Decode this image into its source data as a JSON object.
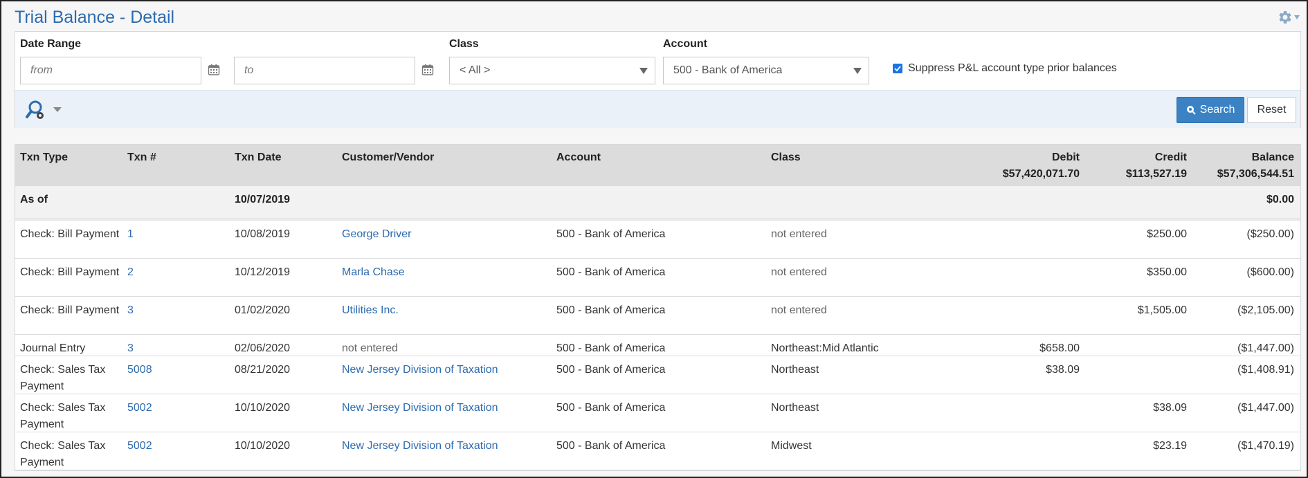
{
  "page": {
    "title": "Trial Balance - Detail"
  },
  "icons": {
    "settings": "gear-icon",
    "calendar": "calendar-icon",
    "advanced_search": "magnifier-gear-icon",
    "search": "search-icon"
  },
  "filters": {
    "date_range": {
      "label": "Date Range",
      "from_placeholder": "from",
      "to_placeholder": "to"
    },
    "class": {
      "label": "Class",
      "value": "< All >"
    },
    "account": {
      "label": "Account",
      "value": "500 - Bank of America"
    },
    "suppress": {
      "label": "Suppress P&L account type prior balances",
      "checked": true
    }
  },
  "toolbar": {
    "search_label": "Search",
    "reset_label": "Reset"
  },
  "table": {
    "headers": {
      "txn_type": "Txn Type",
      "txn_num": "Txn #",
      "txn_date": "Txn Date",
      "customer_vendor": "Customer/Vendor",
      "account": "Account",
      "class": "Class",
      "debit": "Debit",
      "credit": "Credit",
      "balance": "Balance"
    },
    "totals": {
      "debit": "$57,420,071.70",
      "credit": "$113,527.19",
      "balance": "$57,306,544.51"
    },
    "as_of": {
      "label": "As of",
      "date": "10/07/2019",
      "balance": "$0.00"
    },
    "rows": [
      {
        "type": "Check: Bill Payment",
        "num": "1",
        "date": "10/08/2019",
        "cv": "George Driver",
        "cv_link": true,
        "account": "500 - Bank of America",
        "class": "not entered",
        "debit": "",
        "credit": "$250.00",
        "balance": "($250.00)"
      },
      {
        "type": "Check: Bill Payment",
        "num": "2",
        "date": "10/12/2019",
        "cv": "Marla Chase",
        "cv_link": true,
        "account": "500 - Bank of America",
        "class": "not entered",
        "debit": "",
        "credit": "$350.00",
        "balance": "($600.00)"
      },
      {
        "type": "Check: Bill Payment",
        "num": "3",
        "date": "01/02/2020",
        "cv": "Utilities Inc.",
        "cv_link": true,
        "account": "500 - Bank of America",
        "class": "not entered",
        "debit": "",
        "credit": "$1,505.00",
        "balance": "($2,105.00)"
      },
      {
        "type": "Journal Entry",
        "num": "3",
        "date": "02/06/2020",
        "cv": "not entered",
        "cv_link": false,
        "account": "500 - Bank of America",
        "class": "Northeast:Mid Atlantic",
        "debit": "$658.00",
        "credit": "",
        "balance": "($1,447.00)"
      },
      {
        "type": "Check: Sales Tax Payment",
        "num": "5008",
        "date": "08/21/2020",
        "cv": "New Jersey Division of Taxation",
        "cv_link": true,
        "account": "500 - Bank of America",
        "class": "Northeast",
        "debit": "$38.09",
        "credit": "",
        "balance": "($1,408.91)"
      },
      {
        "type": "Check: Sales Tax Payment",
        "num": "5002",
        "date": "10/10/2020",
        "cv": "New Jersey Division of Taxation",
        "cv_link": true,
        "account": "500 - Bank of America",
        "class": "Northeast",
        "debit": "",
        "credit": "$38.09",
        "balance": "($1,447.00)"
      },
      {
        "type": "Check: Sales Tax Payment",
        "num": "5002",
        "date": "10/10/2020",
        "cv": "New Jersey Division of Taxation",
        "cv_link": true,
        "account": "500 - Bank of America",
        "class": "Midwest",
        "debit": "",
        "credit": "$23.19",
        "balance": "($1,470.19)"
      }
    ]
  }
}
